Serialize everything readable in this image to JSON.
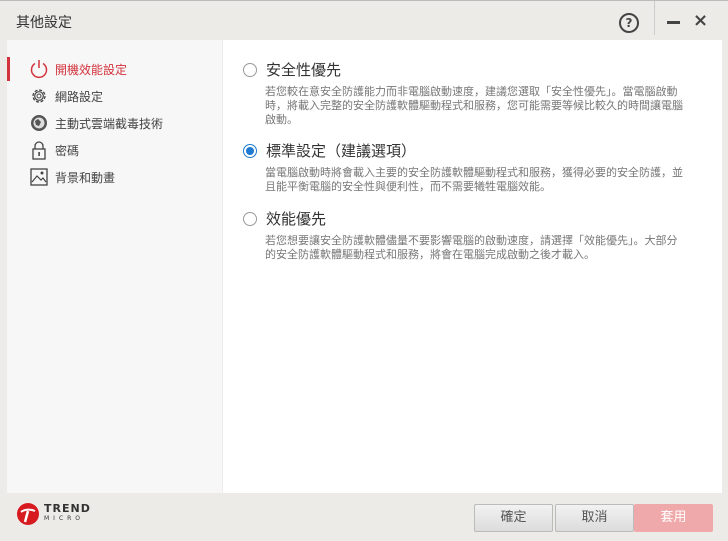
{
  "window": {
    "title": "其他設定",
    "help_icon": "?",
    "close_icon": "×"
  },
  "sidebar": {
    "items": [
      {
        "label": "開機效能設定",
        "icon": "power-icon",
        "active": true
      },
      {
        "label": "網路設定",
        "icon": "gear-icon"
      },
      {
        "label": "主動式雲端截毒技術",
        "icon": "globe-icon"
      },
      {
        "label": "密碼",
        "icon": "lock-icon"
      },
      {
        "label": "背景和動畫",
        "icon": "image-icon"
      }
    ]
  },
  "options": [
    {
      "label": "安全性優先",
      "selected": false,
      "desc": "若您較在意安全防護能力而非電腦啟動速度，建議您選取「安全性優先」。當電腦啟動時，將載入完整的安全防護軟體驅動程式和服務，您可能需要等候比較久的時間讓電腦啟動。"
    },
    {
      "label": "標準設定（建議選項）",
      "selected": true,
      "desc": "當電腦啟動時將會載入主要的安全防護軟體驅動程式和服務，獲得必要的安全防護，並且能平衡電腦的安全性與便利性，而不需要犧牲電腦效能。"
    },
    {
      "label": "效能優先",
      "selected": false,
      "desc": "若您想要讓安全防護軟體儘量不要影響電腦的啟動速度，請選擇「效能優先」。大部分的安全防護軟體驅動程式和服務，將會在電腦完成啟動之後才載入。"
    }
  ],
  "footer": {
    "logo_line1": "TREND",
    "logo_line2": "MICRO",
    "ok": "確定",
    "cancel": "取消",
    "apply": "套用"
  },
  "colors": {
    "accent": "#d3323c",
    "radio": "#1f7ad1"
  }
}
